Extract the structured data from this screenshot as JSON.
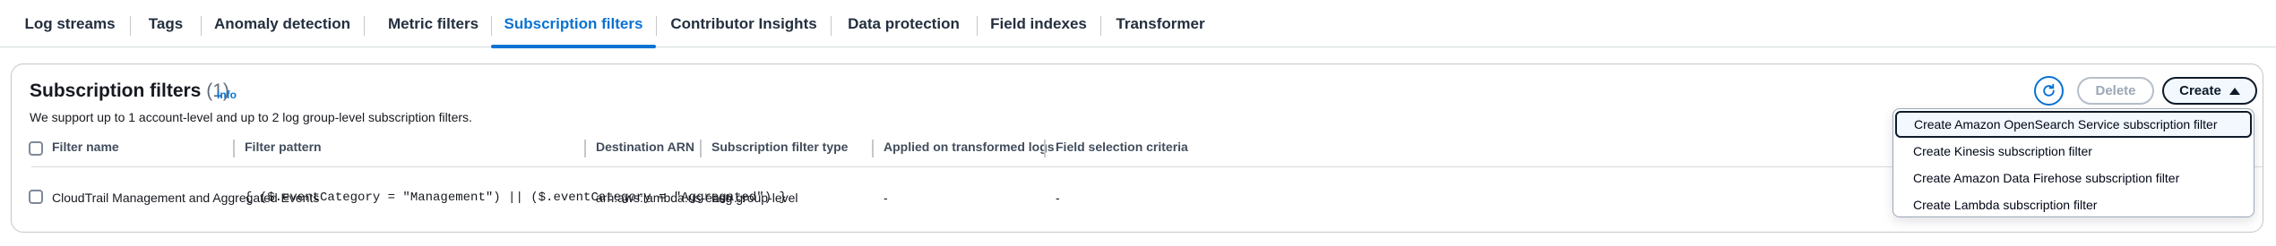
{
  "tabs": [
    {
      "label": "Log streams"
    },
    {
      "label": "Tags"
    },
    {
      "label": "Anomaly detection"
    },
    {
      "label": "Metric filters"
    },
    {
      "label": "Subscription filters"
    },
    {
      "label": "Contributor Insights"
    },
    {
      "label": "Data protection"
    },
    {
      "label": "Field indexes"
    },
    {
      "label": "Transformer"
    }
  ],
  "active_tab": "Subscription filters",
  "panel": {
    "title": "Subscription filters",
    "count": "(1)",
    "info": "Info",
    "description": "We support up to 1 account-level and up to 2 log group-level subscription filters.",
    "delete_label": "Delete",
    "create_label": "Create",
    "refresh_icon": "refresh-icon"
  },
  "table": {
    "columns": [
      "Filter name",
      "Filter pattern",
      "Destination ARN",
      "Subscription filter type",
      "Applied on transformed logs",
      "Field selection criteria"
    ],
    "rows": [
      {
        "filter_name": "CloudTrail Management and Aggregated Events",
        "filter_pattern": "{ ($.eventCategory = \"Management\") || ($.eventCategory = \"Aggregated\") }",
        "destination_arn": "arn:aws:lambda:us-east-…",
        "filter_type": "Log group-level",
        "applied_on_transformed": "-",
        "field_selection": "-"
      }
    ]
  },
  "create_menu": {
    "items": [
      "Create Amazon OpenSearch Service subscription filter",
      "Create Kinesis subscription filter",
      "Create Amazon Data Firehose subscription filter",
      "Create Lambda subscription filter"
    ]
  },
  "colors": {
    "accent": "#0972d3",
    "text": "#16191f",
    "border": "#c6c6cd"
  }
}
